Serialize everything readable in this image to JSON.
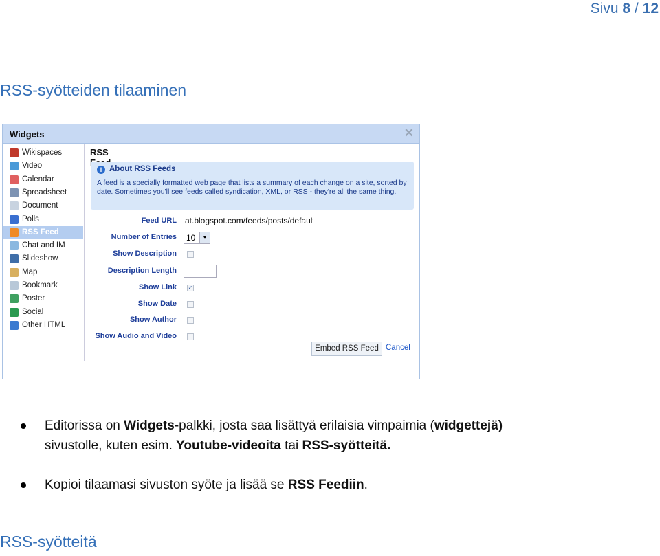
{
  "page_number": {
    "prefix": "Sivu",
    "current": "8",
    "sep": "/",
    "total": "12"
  },
  "heading1": "RSS-syötteiden tilaaminen",
  "dialog": {
    "title": "Widgets",
    "close_icon": "close-icon",
    "sidebar": [
      {
        "label": "Wikispaces",
        "icon": "plant-icon",
        "color": "#c0392b"
      },
      {
        "label": "Video",
        "icon": "tv-icon",
        "color": "#4a9ad8"
      },
      {
        "label": "Calendar",
        "icon": "calendar-icon",
        "color": "#e06060"
      },
      {
        "label": "Spreadsheet",
        "icon": "spreadsheet-icon",
        "color": "#7d93b3"
      },
      {
        "label": "Document",
        "icon": "document-icon",
        "color": "#c8d3e0"
      },
      {
        "label": "Polls",
        "icon": "bar-chart-icon",
        "color": "#3a6fd0"
      },
      {
        "label": "RSS Feed",
        "icon": "rss-icon",
        "color": "#f08a24",
        "selected": true
      },
      {
        "label": "Chat and IM",
        "icon": "chat-icon",
        "color": "#8ab8e0"
      },
      {
        "label": "Slideshow",
        "icon": "slideshow-icon",
        "color": "#3f6ea8"
      },
      {
        "label": "Map",
        "icon": "map-icon",
        "color": "#d8b060"
      },
      {
        "label": "Bookmark",
        "icon": "bookmark-icon",
        "color": "#b8c8d8"
      },
      {
        "label": "Poster",
        "icon": "poster-icon",
        "color": "#3fa060"
      },
      {
        "label": "Social",
        "icon": "social-icon",
        "color": "#2a9a50"
      },
      {
        "label": "Other HTML",
        "icon": "html-icon",
        "color": "#3a7ad0"
      }
    ],
    "content": {
      "title": "RSS Feed",
      "info_title": "About RSS Feeds",
      "info_text": "A feed is a specially formatted web page that lists a summary of each change on a site, sorted by date. Sometimes you'll see feeds called syndication, XML, or RSS - they're all the same thing.",
      "fields": {
        "feed_url_label": "Feed URL",
        "feed_url_value": "at.blogspot.com/feeds/posts/default",
        "entries_label": "Number of Entries",
        "entries_value": "10",
        "show_description_label": "Show Description",
        "show_description": false,
        "description_length_label": "Description Length",
        "description_length_value": "",
        "show_link_label": "Show Link",
        "show_link": true,
        "show_date_label": "Show Date",
        "show_date": false,
        "show_author_label": "Show Author",
        "show_author": false,
        "show_audio_video_label": "Show Audio and Video",
        "show_audio_video": false
      },
      "embed_button": "Embed RSS Feed",
      "cancel_link": "Cancel"
    }
  },
  "bullets": [
    {
      "parts": [
        "Editorissa on ",
        "Widgets",
        "-palkki, josta saa lisättyä erilaisia vimpaimia (",
        "widgettejä)"
      ],
      "line2": [
        "sivustolle, kuten esim. ",
        "Youtube-videoita",
        " tai ",
        "RSS-syötteitä."
      ]
    },
    {
      "parts": [
        "Kopioi tilaamasi sivuston syöte ja lisää se ",
        "RSS Feediin",
        "."
      ]
    }
  ],
  "heading2": "RSS-syötteitä"
}
